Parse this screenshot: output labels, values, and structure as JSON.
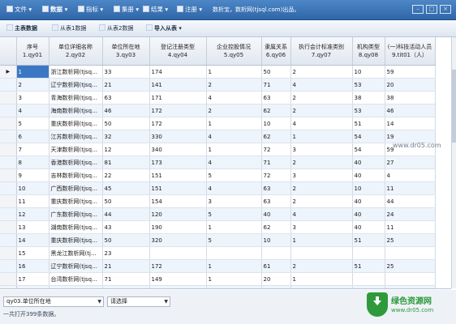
{
  "menubar": {
    "items": [
      {
        "label": "文件",
        "icon": "chart-icon",
        "bold": false
      },
      {
        "label": "数据",
        "icon": "folder-icon",
        "bold": true
      },
      {
        "label": "指标",
        "icon": "folder-icon",
        "bold": false
      },
      {
        "label": "集册",
        "icon": "folder-icon",
        "bold": false
      },
      {
        "label": "结果",
        "icon": "folder-icon",
        "bold": false
      },
      {
        "label": "注册",
        "icon": "key-icon",
        "bold": false
      }
    ],
    "note": "数析宝，数析网(tjsql.com)出品。"
  },
  "toolbar": {
    "items": [
      {
        "label": "主表数据",
        "bold": true
      },
      {
        "label": "从表1数据",
        "bold": false
      },
      {
        "label": "从表2数据",
        "bold": false
      },
      {
        "label": "导入从表",
        "bold": true
      }
    ]
  },
  "grid": {
    "columns": [
      {
        "name": "序号",
        "code": "1.qy01"
      },
      {
        "name": "单位详细名称",
        "code": "2.qy02"
      },
      {
        "name": "单位所在地",
        "code": "3.qy03"
      },
      {
        "name": "登记注册类型",
        "code": "4.qy04"
      },
      {
        "name": "企业控股情况",
        "code": "5.qy05"
      },
      {
        "name": "隶属关系",
        "code": "6.qy06"
      },
      {
        "name": "执行会计标准类别",
        "code": "7.qy07"
      },
      {
        "name": "机构类型",
        "code": "8.qy08"
      },
      {
        "name": "(一)科技活动人员",
        "code": "9.tit01（人）"
      }
    ],
    "rows": [
      [
        "1",
        "浙江数析网(tjsq…",
        "33",
        "174",
        "1",
        "50",
        "2",
        "10",
        "59"
      ],
      [
        "2",
        "辽宁数析网(tjsq…",
        "21",
        "141",
        "2",
        "71",
        "4",
        "53",
        "20"
      ],
      [
        "3",
        "青海数析网(tjsq…",
        "63",
        "171",
        "4",
        "63",
        "2",
        "38",
        "38"
      ],
      [
        "4",
        "海南数析网(tjsq…",
        "46",
        "172",
        "2",
        "62",
        "2",
        "53",
        "46"
      ],
      [
        "5",
        "重庆数析网(tjsq…",
        "50",
        "172",
        "1",
        "10",
        "4",
        "51",
        "14"
      ],
      [
        "6",
        "江苏数析网(tjsq…",
        "32",
        "330",
        "4",
        "62",
        "1",
        "54",
        "19"
      ],
      [
        "7",
        "天津数析网(tjsq…",
        "12",
        "340",
        "1",
        "72",
        "3",
        "54",
        "59"
      ],
      [
        "8",
        "香港数析网(tjsq…",
        "81",
        "173",
        "4",
        "71",
        "2",
        "40",
        "27"
      ],
      [
        "9",
        "吉林数析网(tjsq…",
        "22",
        "151",
        "5",
        "72",
        "3",
        "40",
        "4"
      ],
      [
        "10",
        "广西数析网(tjsq…",
        "45",
        "151",
        "4",
        "63",
        "2",
        "10",
        "11"
      ],
      [
        "11",
        "重庆数析网(tjsq…",
        "50",
        "154",
        "3",
        "63",
        "2",
        "40",
        "44"
      ],
      [
        "12",
        "广东数析网(tjsq…",
        "44",
        "120",
        "5",
        "40",
        "4",
        "40",
        "24"
      ],
      [
        "13",
        "湖南数析网(tjsq…",
        "43",
        "190",
        "1",
        "62",
        "3",
        "40",
        "11"
      ],
      [
        "14",
        "重庆数析网(tjsq…",
        "50",
        "320",
        "5",
        "10",
        "1",
        "51",
        "25"
      ],
      [
        "15",
        "黑龙江数析网(tj…",
        "23",
        "",
        "",
        "",
        "",
        "",
        ""
      ],
      [
        "16",
        "辽宁数析网(tjsq…",
        "21",
        "172",
        "1",
        "61",
        "2",
        "51",
        "25"
      ],
      [
        "17",
        "台湾数析网(tjsq…",
        "71",
        "149",
        "1",
        "20",
        "1",
        "",
        ""
      ],
      [
        "18",
        "北京数析网(tjsq…",
        "11",
        "172",
        "2",
        "10",
        "2",
        "51",
        "25"
      ],
      [
        "19",
        "重庆数析网(tjsq…",
        "50",
        "",
        "",
        "",
        "",
        "",
        ""
      ]
    ],
    "current_row": 0,
    "indicator": "▶"
  },
  "watermark": "www.dr05.com",
  "footer": {
    "field_select": "qy03.单位所在地",
    "value_select": "请选择",
    "status": "一共打开399条数据。"
  },
  "logo": {
    "title": "绿色资源网",
    "url": "www.dr05.com"
  }
}
